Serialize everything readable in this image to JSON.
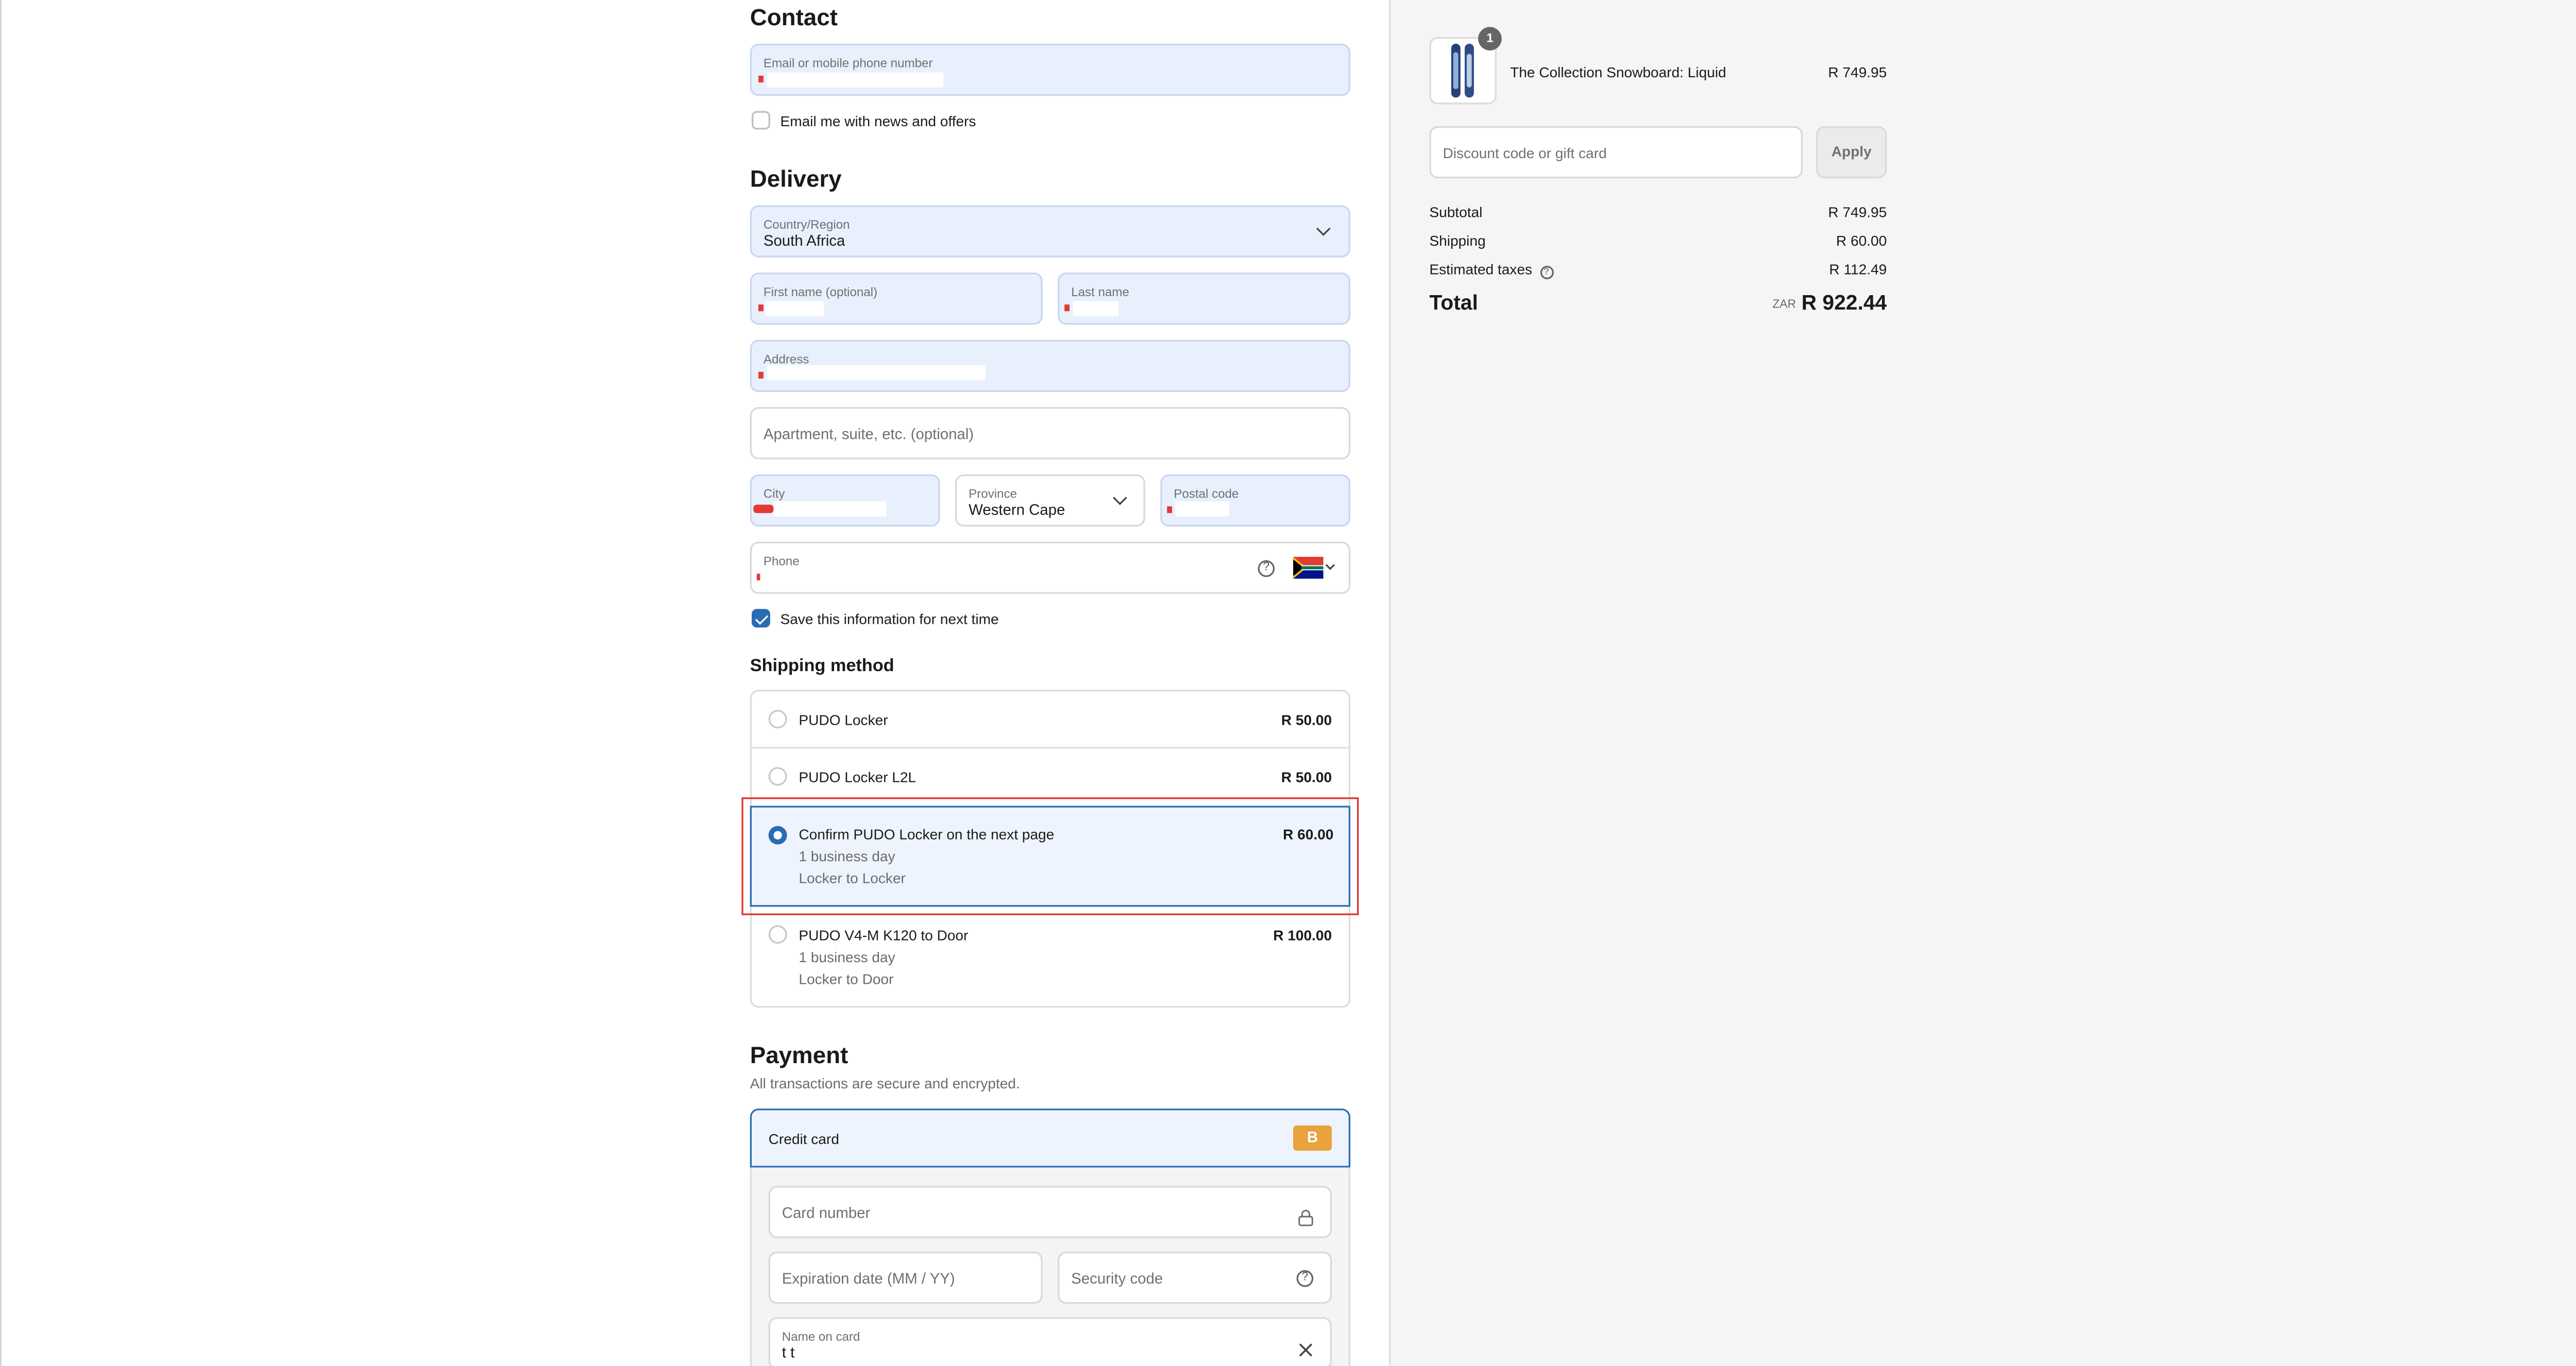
{
  "contact": {
    "heading": "Contact",
    "email_label": "Email or mobile phone number",
    "newsletter_label": "Email me with news and offers",
    "newsletter_checked": false
  },
  "delivery": {
    "heading": "Delivery",
    "country_label": "Country/Region",
    "country_value": "South Africa",
    "first_name_label": "First name (optional)",
    "last_name_label": "Last name",
    "address_label": "Address",
    "apartment_placeholder": "Apartment, suite, etc. (optional)",
    "city_label": "City",
    "province_label": "Province",
    "province_value": "Western Cape",
    "postal_label": "Postal code",
    "phone_label": "Phone",
    "save_info_label": "Save this information for next time",
    "save_info_checked": true
  },
  "shipping": {
    "heading": "Shipping method",
    "options": [
      {
        "name": "PUDO Locker",
        "price": "R 50.00",
        "selected": false
      },
      {
        "name": "PUDO Locker L2L",
        "price": "R 50.00",
        "selected": false
      },
      {
        "name": "Confirm PUDO Locker on the next page",
        "price": "R 60.00",
        "detail1": "1 business day",
        "detail2": "Locker to Locker",
        "selected": true
      },
      {
        "name": "PUDO V4-M K120 to Door",
        "price": "R 100.00",
        "detail1": "1 business day",
        "detail2": "Locker to Door",
        "selected": false
      }
    ]
  },
  "payment": {
    "heading": "Payment",
    "subtitle": "All transactions are secure and encrypted.",
    "method_label": "Credit card",
    "method_badge": "B",
    "card_number_placeholder": "Card number",
    "expiry_placeholder": "Expiration date (MM / YY)",
    "security_placeholder": "Security code",
    "name_on_card_label": "Name on card",
    "name_on_card_value": "t t"
  },
  "order": {
    "item_quantity": "1",
    "item_name": "The Collection Snowboard: Liquid",
    "item_price": "R 749.95",
    "discount_placeholder": "Discount code or gift card",
    "apply_label": "Apply",
    "subtotal_label": "Subtotal",
    "subtotal_value": "R 749.95",
    "shipping_label": "Shipping",
    "shipping_value": "R 60.00",
    "taxes_label": "Estimated taxes",
    "taxes_value": "R 112.49",
    "total_label": "Total",
    "total_currency": "ZAR",
    "total_value": "R 922.44"
  },
  "colors": {
    "accent": "#2a6bb5",
    "autofill_bg": "#e8f0fe",
    "highlight_frame": "#e0312b",
    "badge": "#e8a33d"
  }
}
